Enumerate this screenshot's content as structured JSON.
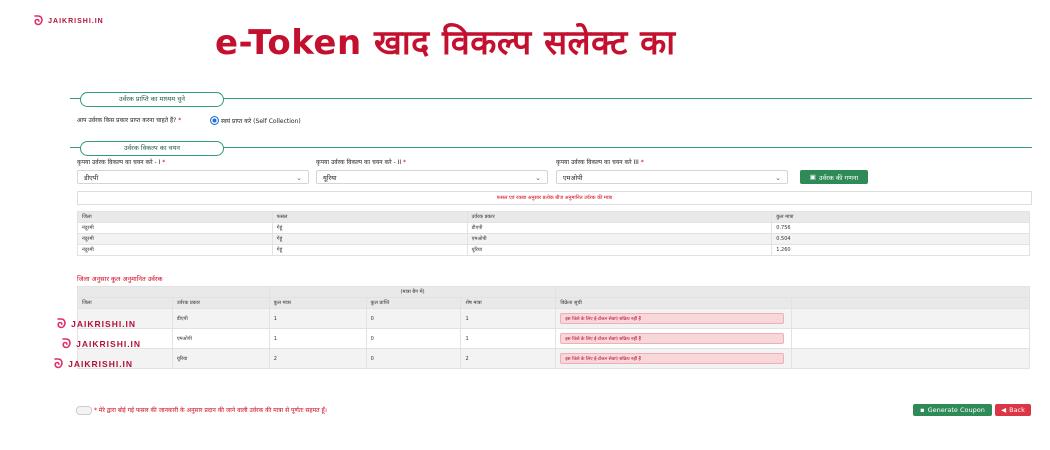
{
  "brand": "JAIKRISHI.IN",
  "banner": {
    "title": "e-Token  खाद विकल्प सलेक्ट का"
  },
  "section1": {
    "title": "उर्वरक प्राप्ति का माध्यम चुने",
    "question": "आप उर्वरक किस प्रकार प्राप्त करना चाहते हैं?",
    "required_mark": "*",
    "radio_label": "स्वयं प्राप्त करे (Self Collection)"
  },
  "section2": {
    "title": "उर्वरक विकल्प का चयन",
    "selects": [
      {
        "label": "कृपया उर्वरक विकल्प का चयन करे - I",
        "value": "डीएपी"
      },
      {
        "label": "कृपया उर्वरक विकल्प का चयन करे - II",
        "value": "यूरिया"
      },
      {
        "label": "कृपया उर्वरक विकल्प का चयन करे III",
        "value": "एमओपी"
      }
    ],
    "calc_button": "उर्वरक की गणना",
    "info_message": "फसल एवं रकबा अनुसार प्रत्येक बीज अनुमानित उर्वरक की मात्रा"
  },
  "table1": {
    "headers": [
      "जिला",
      "फसल",
      "उर्वरक प्रकार",
      "कुल मात्रा"
    ],
    "rows": [
      [
        "नंदुरमी",
        "गेहूं",
        "डीएपी",
        "0.756"
      ],
      [
        "नंदुरमी",
        "गेहूं",
        "एमओपी",
        "0.504"
      ],
      [
        "नंदुरमी",
        "गेहूं",
        "यूरिया",
        "1.260"
      ]
    ]
  },
  "table2": {
    "title": "जिला अनुसार कुल अनुमानित उर्वरक",
    "unit_note": "(मात्रा बैग में)",
    "headers": [
      "जिला",
      "उर्वरक प्रकार",
      "कुल मात्रा",
      "कुल प्राप्ति",
      "शेष मात्रा",
      "विक्रेता सूची"
    ],
    "rows": [
      {
        "type": "डीएपी",
        "total": "1",
        "received": "0",
        "remaining": "1",
        "seller": "इस जिले के लिए ई-टोकन सेवाएं सक्रिय नहीं हैं"
      },
      {
        "type": "एमओपी",
        "total": "1",
        "received": "0",
        "remaining": "1",
        "seller": "इस जिले के लिए ई-टोकन सेवाएं सक्रिय नहीं हैं"
      },
      {
        "type": "यूरिया",
        "total": "2",
        "received": "0",
        "remaining": "2",
        "seller": "इस जिले के लिए ई-टोकन सेवाएं सक्रिय नहीं हैं"
      }
    ]
  },
  "consent": {
    "text": "* मेरे द्वारा बोई गई फसल की जानकारी के अनुसार प्रदान की जाने वाली उर्वरक की मात्रा से पूर्णतः सहमत हूँ।"
  },
  "actions": {
    "generate": "Generate Coupon",
    "back": "Back"
  },
  "icons": {
    "save": "save-icon",
    "back": "arrow-left-icon",
    "chevron": "chevron-down-icon",
    "doc": "document-icon"
  },
  "colors": {
    "brand_red": "#c4102f",
    "accent_green": "#2e8b57",
    "danger": "#dc3545"
  }
}
